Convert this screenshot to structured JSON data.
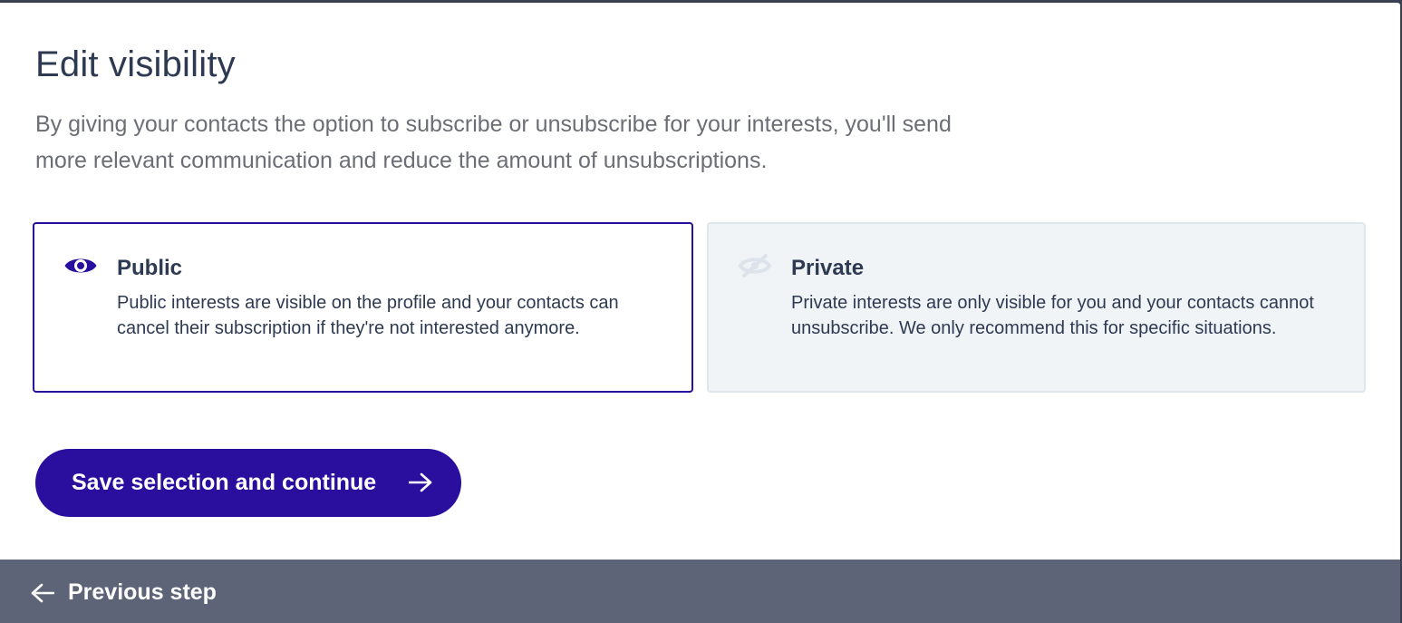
{
  "dialog": {
    "title": "Edit visibility",
    "description": "By giving your contacts the option to subscribe or unsubscribe for your interests, you'll send more relevant communication and reduce the amount of unsubscriptions."
  },
  "options": [
    {
      "id": "public",
      "title": "Public",
      "text": "Public interests are visible on the profile and your contacts can cancel their subscription if they're not interested anymore.",
      "icon": "eye-icon",
      "selected": true
    },
    {
      "id": "private",
      "title": "Private",
      "text": "Private interests are only visible for you and your contacts cannot unsubscribe. We only recommend this for specific situations.",
      "icon": "eye-slash-icon",
      "selected": false
    }
  ],
  "actions": {
    "save_label": "Save selection and continue",
    "previous_label": "Previous step"
  },
  "colors": {
    "primary": "#2a0f9e",
    "text": "#2e3a52",
    "muted_text": "#6b6e76",
    "footer": "#5e6478",
    "private_bg": "#f0f4f7"
  }
}
